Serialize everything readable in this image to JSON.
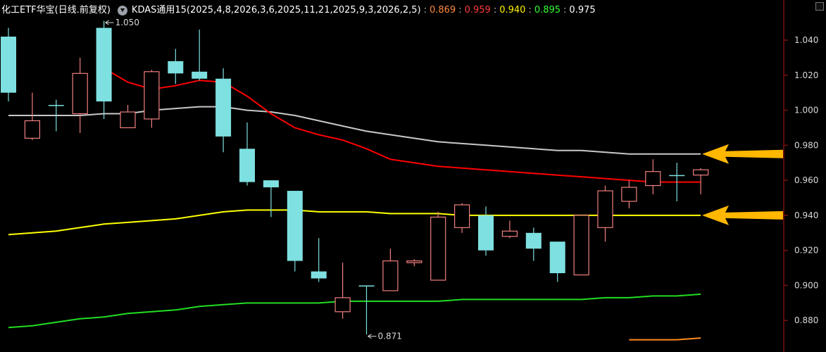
{
  "header": {
    "title": "化工ETF华宝(日线.前复权)",
    "indicator": "KDAS通用15(2025,4,8,2026,3,6,2025,11,21,2025,9,3,2026,2,5)",
    "values": [
      "0.869",
      "0.959",
      "0.940",
      "0.895",
      "0.975"
    ],
    "separator": ":"
  },
  "colors": {
    "background": "#000000",
    "up_candle": "#f07f7f",
    "down_candle": "#7ee0e0",
    "line_red": "#ff0000",
    "line_gray": "#c8c8c8",
    "line_yellow": "#ffff00",
    "line_green": "#22dd22",
    "line_orange": "#ff8c1a",
    "arrow": "#ffb700",
    "axis": "#7a1010"
  },
  "chart_data": {
    "type": "candlestick",
    "ylim": [
      0.871,
      1.054
    ],
    "y_ticks": [
      "1.040",
      "1.020",
      "1.000",
      "0.980",
      "0.960",
      "0.940",
      "0.920",
      "0.900",
      "0.880"
    ],
    "annotations": [
      {
        "label": "1.050",
        "candle": 4,
        "value": 1.05
      },
      {
        "label": "0.871",
        "candle": 15,
        "value": 0.871
      }
    ],
    "candles": [
      {
        "o": 1.042,
        "h": 1.047,
        "l": 1.005,
        "c": 1.01
      },
      {
        "o": 0.984,
        "h": 1.01,
        "l": 0.983,
        "c": 0.994
      },
      {
        "o": 1.003,
        "h": 1.006,
        "l": 0.988,
        "c": 1.003
      },
      {
        "o": 0.998,
        "h": 1.03,
        "l": 0.987,
        "c": 1.021
      },
      {
        "o": 1.047,
        "h": 1.051,
        "l": 0.995,
        "c": 1.005
      },
      {
        "o": 0.99,
        "h": 1.003,
        "l": 0.99,
        "c": 0.999
      },
      {
        "o": 0.995,
        "h": 1.023,
        "l": 0.99,
        "c": 1.022
      },
      {
        "o": 1.028,
        "h": 1.035,
        "l": 1.015,
        "c": 1.021
      },
      {
        "o": 1.022,
        "h": 1.046,
        "l": 1.017,
        "c": 1.018
      },
      {
        "o": 1.018,
        "h": 1.024,
        "l": 0.976,
        "c": 0.985
      },
      {
        "o": 0.978,
        "h": 0.993,
        "l": 0.957,
        "c": 0.959
      },
      {
        "o": 0.96,
        "h": 0.96,
        "l": 0.939,
        "c": 0.956
      },
      {
        "o": 0.954,
        "h": 0.954,
        "l": 0.908,
        "c": 0.914
      },
      {
        "o": 0.908,
        "h": 0.927,
        "l": 0.902,
        "c": 0.904
      },
      {
        "o": 0.885,
        "h": 0.913,
        "l": 0.881,
        "c": 0.893
      },
      {
        "o": 0.9,
        "h": 0.9,
        "l": 0.872,
        "c": 0.9
      },
      {
        "o": 0.897,
        "h": 0.921,
        "l": 0.897,
        "c": 0.914
      },
      {
        "o": 0.913,
        "h": 0.915,
        "l": 0.911,
        "c": 0.914
      },
      {
        "o": 0.903,
        "h": 0.942,
        "l": 0.903,
        "c": 0.939
      },
      {
        "o": 0.933,
        "h": 0.947,
        "l": 0.93,
        "c": 0.946
      },
      {
        "o": 0.94,
        "h": 0.945,
        "l": 0.917,
        "c": 0.92
      },
      {
        "o": 0.928,
        "h": 0.937,
        "l": 0.927,
        "c": 0.931
      },
      {
        "o": 0.93,
        "h": 0.933,
        "l": 0.914,
        "c": 0.921
      },
      {
        "o": 0.925,
        "h": 0.925,
        "l": 0.902,
        "c": 0.907
      },
      {
        "o": 0.906,
        "h": 0.94,
        "l": 0.906,
        "c": 0.94
      },
      {
        "o": 0.933,
        "h": 0.957,
        "l": 0.925,
        "c": 0.954
      },
      {
        "o": 0.948,
        "h": 0.96,
        "l": 0.944,
        "c": 0.956
      },
      {
        "o": 0.957,
        "h": 0.972,
        "l": 0.952,
        "c": 0.965
      },
      {
        "o": 0.963,
        "h": 0.97,
        "l": 0.948,
        "c": 0.963
      },
      {
        "o": 0.963,
        "h": 0.967,
        "l": 0.952,
        "c": 0.966
      }
    ],
    "series": [
      {
        "key": "gray",
        "values": [
          0.997,
          0.997,
          0.997,
          0.997,
          0.998,
          0.998,
          1.0,
          1.001,
          1.002,
          1.002,
          1.0,
          0.999,
          0.997,
          0.994,
          0.991,
          0.988,
          0.986,
          0.984,
          0.982,
          0.981,
          0.98,
          0.979,
          0.978,
          0.977,
          0.977,
          0.976,
          0.975,
          0.975,
          0.975,
          0.975
        ]
      },
      {
        "key": "red",
        "start": 4,
        "values": [
          1.024,
          1.016,
          1.012,
          1.014,
          1.017,
          1.016,
          1.008,
          0.998,
          0.99,
          0.986,
          0.983,
          0.978,
          0.972,
          0.97,
          0.968,
          0.967,
          0.966,
          0.965,
          0.964,
          0.963,
          0.962,
          0.961,
          0.96,
          0.959,
          0.959,
          0.959
        ]
      },
      {
        "key": "yellow",
        "values": [
          0.929,
          0.93,
          0.931,
          0.933,
          0.935,
          0.936,
          0.937,
          0.938,
          0.94,
          0.942,
          0.943,
          0.943,
          0.943,
          0.942,
          0.942,
          0.942,
          0.941,
          0.941,
          0.941,
          0.94,
          0.94,
          0.94,
          0.94,
          0.94,
          0.94,
          0.94,
          0.94,
          0.94,
          0.94,
          0.94
        ]
      },
      {
        "key": "green",
        "values": [
          0.876,
          0.877,
          0.879,
          0.881,
          0.882,
          0.884,
          0.885,
          0.886,
          0.888,
          0.889,
          0.89,
          0.89,
          0.89,
          0.89,
          0.891,
          0.891,
          0.891,
          0.891,
          0.891,
          0.892,
          0.892,
          0.892,
          0.892,
          0.892,
          0.892,
          0.893,
          0.893,
          0.894,
          0.894,
          0.895
        ]
      },
      {
        "key": "orange",
        "start": 26,
        "values": [
          0.869,
          0.869,
          0.869,
          0.87
        ]
      }
    ]
  }
}
